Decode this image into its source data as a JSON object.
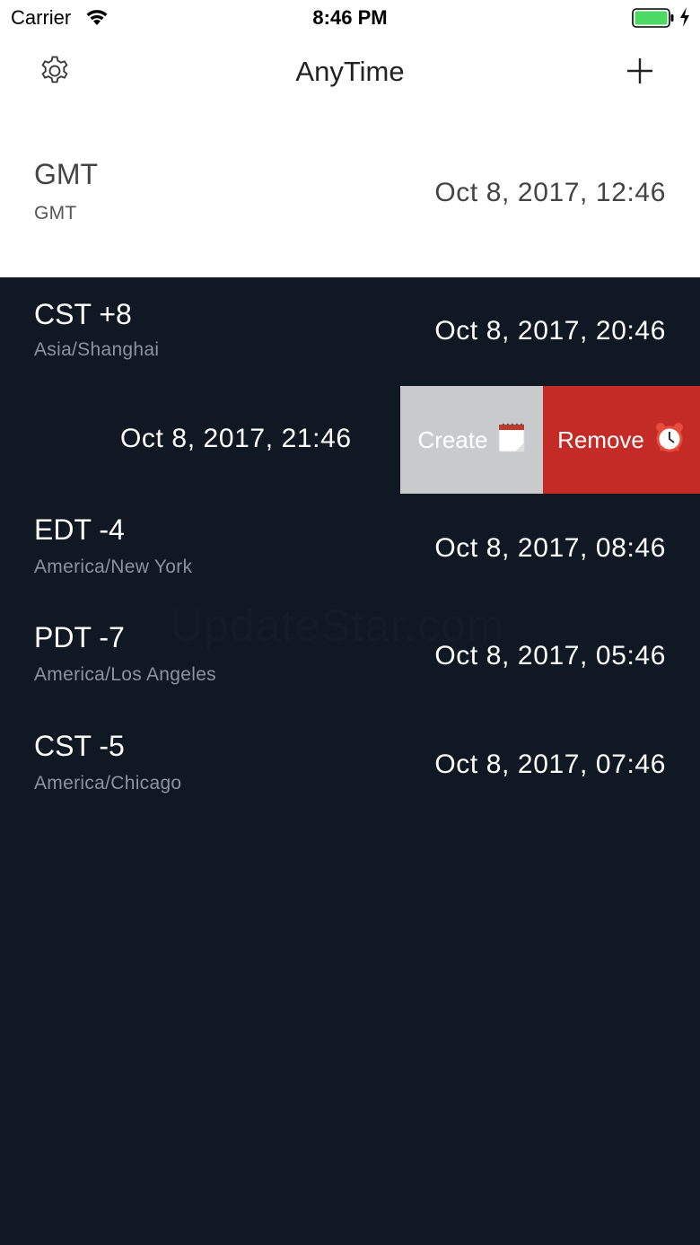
{
  "status_bar": {
    "carrier": "Carrier",
    "time": "8:46 PM"
  },
  "nav": {
    "title": "AnyTime",
    "left_icon": "gear-icon",
    "right_icon": "plus-icon"
  },
  "rows": [
    {
      "abbr": "GMT",
      "zone": "GMT",
      "time": "Oct 8, 2017, 12:46"
    },
    {
      "abbr": "CST +8",
      "zone": "Asia/Shanghai",
      "time": "Oct 8, 2017, 20:46"
    },
    {
      "time": "Oct 8, 2017, 21:46"
    },
    {
      "abbr": "EDT -4",
      "zone": "America/New York",
      "time": "Oct 8, 2017, 08:46"
    },
    {
      "abbr": "PDT -7",
      "zone": "America/Los Angeles",
      "time": "Oct 8, 2017, 05:46"
    },
    {
      "abbr": "CST -5",
      "zone": "America/Chicago",
      "time": "Oct 8, 2017, 07:46"
    }
  ],
  "swipe_actions": {
    "create_label": "Create",
    "create_icon": "notepad-icon",
    "remove_label": "Remove",
    "remove_icon": "alarm-clock-icon"
  },
  "watermark": "UpdateStar.com",
  "colors": {
    "background": "#101923",
    "header_background": "#ffffff",
    "create_action": "#c9cacc",
    "remove_action": "#c42b26",
    "battery": "#4cd964"
  }
}
